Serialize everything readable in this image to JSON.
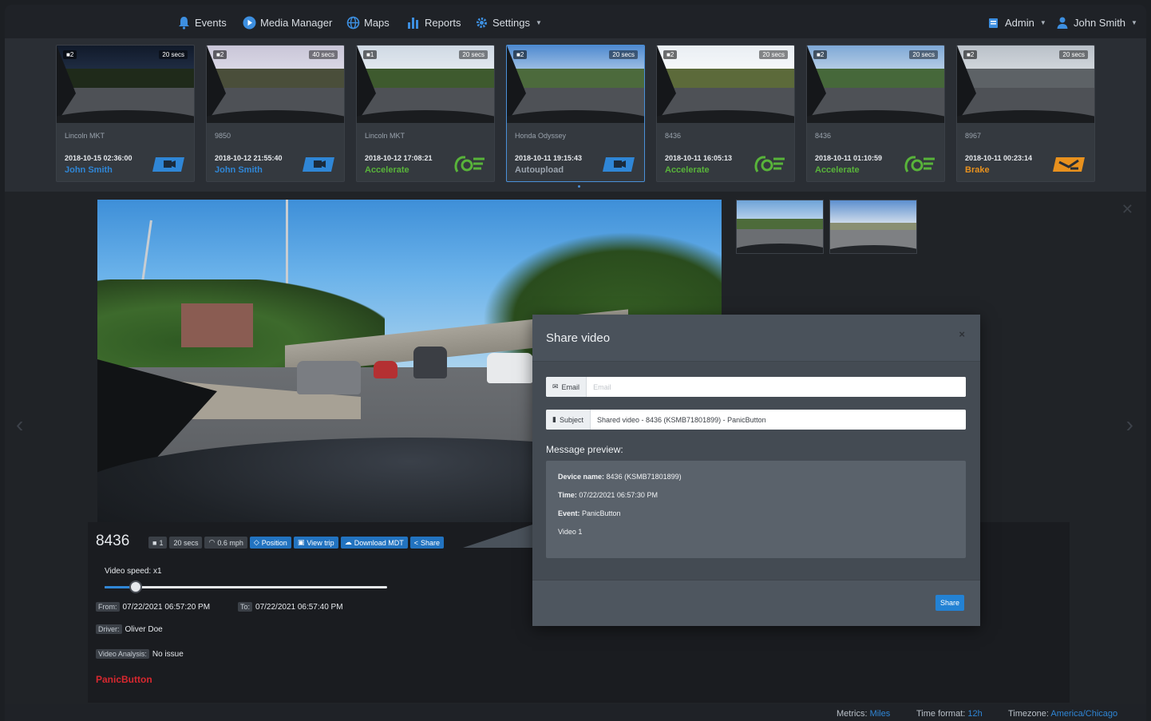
{
  "nav": {
    "items": [
      {
        "label": "Events",
        "icon": "bell-icon"
      },
      {
        "label": "Media Manager",
        "icon": "play-icon"
      },
      {
        "label": "Maps",
        "icon": "globe-icon"
      },
      {
        "label": "Reports",
        "icon": "bar-chart-icon"
      },
      {
        "label": "Settings",
        "icon": "gear-icon"
      }
    ],
    "admin": "Admin",
    "user": "John Smith"
  },
  "events": [
    {
      "cam": "■2",
      "duration": "20 secs",
      "vehicle": "Lincoln MKT",
      "timestamp": "2018-10-15 02:36:00",
      "subtitle": "John Smith",
      "subtitle_color": "blue",
      "icon": "camera-event-icon"
    },
    {
      "cam": "■2",
      "duration": "40 secs",
      "vehicle": "9850",
      "timestamp": "2018-10-12 21:55:40",
      "subtitle": "John Smith",
      "subtitle_color": "blue",
      "icon": "camera-event-icon"
    },
    {
      "cam": "■1",
      "duration": "20 secs",
      "vehicle": "Lincoln MKT",
      "timestamp": "2018-10-12 17:08:21",
      "subtitle": "Accelerate",
      "subtitle_color": "green",
      "icon": "accelerate-icon"
    },
    {
      "cam": "■2",
      "duration": "20 secs",
      "vehicle": "Honda Odyssey",
      "timestamp": "2018-10-11 19:15:43",
      "subtitle": "Autoupload",
      "subtitle_color": "gray",
      "icon": "camera-event-icon"
    },
    {
      "cam": "■2",
      "duration": "20 secs",
      "vehicle": "8436",
      "timestamp": "2018-10-11 16:05:13",
      "subtitle": "Accelerate",
      "subtitle_color": "green",
      "icon": "accelerate-icon"
    },
    {
      "cam": "■2",
      "duration": "20 secs",
      "vehicle": "8436",
      "timestamp": "2018-10-11 01:10:59",
      "subtitle": "Accelerate",
      "subtitle_color": "green",
      "icon": "accelerate-icon"
    },
    {
      "cam": "■2",
      "duration": "20 secs",
      "vehicle": "8967",
      "timestamp": "2018-10-11 00:23:14",
      "subtitle": "Brake",
      "subtitle_color": "orange",
      "icon": "brake-icon"
    }
  ],
  "selected_event_index": 3,
  "video": {
    "device": "8436",
    "chips": {
      "camera": "1",
      "duration": "20 secs",
      "speed": "0.6 mph",
      "position": "Position",
      "view_trip": "View trip",
      "download": "Download MDT",
      "share": "Share"
    },
    "speed_label": "Video speed: x1",
    "speed_fraction": 0.11,
    "from_label": "From:",
    "from": "07/22/2021 06:57:20 PM",
    "to_label": "To:",
    "to": "07/22/2021 06:57:40 PM",
    "driver_label": "Driver:",
    "driver": "Oliver Doe",
    "analysis_label": "Video Analysis:",
    "analysis": "No issue",
    "event_name": "PanicButton"
  },
  "modal": {
    "title": "Share video",
    "close": "×",
    "email_label": "Email",
    "email_placeholder": "Email",
    "subject_label": "Subject",
    "subject_value": "Shared video - 8436 (KSMB71801899) - PanicButton",
    "preview_label": "Message preview:",
    "preview": {
      "device_label": "Device name:",
      "device": "8436 (KSMB71801899)",
      "time_label": "Time:",
      "time": "07/22/2021 06:57:30 PM",
      "event_label": "Event:",
      "event": "PanicButton",
      "video": "Video 1"
    },
    "share_button": "Share"
  },
  "footer": {
    "metrics_label": "Metrics:",
    "metrics": "Miles",
    "time_format_label": "Time format:",
    "time_format": "12h",
    "timezone_label": "Timezone:",
    "timezone": "America/Chicago"
  },
  "colors": {
    "accent_blue": "#2f86d6",
    "accelerate_green": "#58b33a",
    "brake_orange": "#e8911e",
    "event_red": "#d7282f"
  }
}
